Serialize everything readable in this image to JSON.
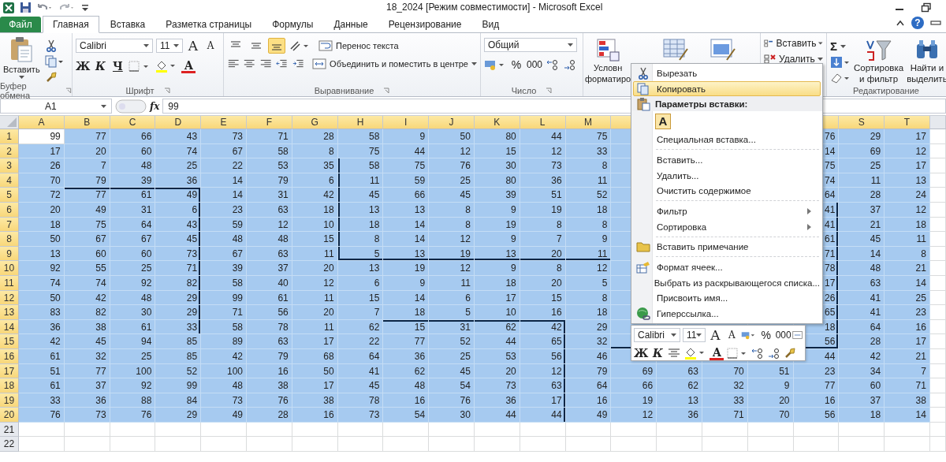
{
  "window": {
    "title": "18_2024  [Режим совместимости]  -  Microsoft Excel"
  },
  "tabs": [
    {
      "label": "Файл",
      "kind": "file",
      "selected": false
    },
    {
      "label": "Главная",
      "kind": "tab",
      "selected": true
    },
    {
      "label": "Вставка",
      "kind": "tab",
      "selected": false
    },
    {
      "label": "Разметка страницы",
      "kind": "tab",
      "selected": false
    },
    {
      "label": "Формулы",
      "kind": "tab",
      "selected": false
    },
    {
      "label": "Данные",
      "kind": "tab",
      "selected": false
    },
    {
      "label": "Рецензирование",
      "kind": "tab",
      "selected": false
    },
    {
      "label": "Вид",
      "kind": "tab",
      "selected": false
    }
  ],
  "help": {
    "label": "?"
  },
  "ribbon": {
    "clipboard": {
      "label": "Буфер обмена",
      "paste": "Вставить"
    },
    "font": {
      "label": "Шрифт",
      "name": "Calibri",
      "size": "11",
      "grow": "A",
      "shrink": "A",
      "bold": "Ж",
      "italic": "К",
      "underline": "Ч",
      "color_label": "A"
    },
    "alignment": {
      "label": "Выравнивание",
      "wrap": "Перенос текста",
      "merge": "Объединить и поместить в центре",
      "vertical": [
        {
          "kind": "top",
          "selected": false
        },
        {
          "kind": "middle",
          "selected": false
        },
        {
          "kind": "bottom",
          "selected": true
        }
      ]
    },
    "number": {
      "label": "Число",
      "format": "Общий",
      "percent": "%",
      "thousands": "000"
    },
    "styles": {
      "conditional": [
        "Условн",
        "форматиро"
      ]
    },
    "cells": {
      "insert": "Вставить",
      "delete": "Удалить"
    },
    "editing": {
      "label": "Редактирование",
      "sum": "Σ",
      "sort": [
        "Сортировка",
        "и фильтр"
      ],
      "find": [
        "Найти и",
        "выделить"
      ]
    }
  },
  "formula_bar": {
    "name_box": "A1",
    "function_label": "fx",
    "formula": "99"
  },
  "sheet": {
    "columns": [
      {
        "label": "A",
        "selected": true
      },
      {
        "label": "B",
        "selected": true
      },
      {
        "label": "C",
        "selected": true
      },
      {
        "label": "D",
        "selected": true
      },
      {
        "label": "E",
        "selected": true
      },
      {
        "label": "F",
        "selected": true
      },
      {
        "label": "G",
        "selected": true
      },
      {
        "label": "H",
        "selected": true
      },
      {
        "label": "I",
        "selected": true
      },
      {
        "label": "J",
        "selected": true
      },
      {
        "label": "K",
        "selected": true
      },
      {
        "label": "L",
        "selected": true
      },
      {
        "label": "M",
        "selected": true
      },
      null,
      null,
      null,
      null,
      {
        "selected": true
      },
      {
        "label": "S",
        "selected": true
      },
      {
        "label": "T",
        "selected": true
      }
    ],
    "rows": [
      {
        "num": "1",
        "selected": true,
        "cells": [
          {
            "text": "99",
            "active": true
          },
          "77",
          "66",
          "43",
          "73",
          "71",
          "28",
          "58",
          "9",
          "50",
          "80",
          "44",
          "75",
          null,
          null,
          null,
          null,
          "76",
          "29",
          "17"
        ]
      },
      {
        "num": "2",
        "selected": true,
        "cells": [
          "17",
          "20",
          "60",
          "74",
          "67",
          "58",
          "8",
          "75",
          "44",
          "12",
          "15",
          "12",
          "33",
          null,
          null,
          null,
          null,
          "14",
          "69",
          "12"
        ]
      },
      {
        "num": "3",
        "selected": true,
        "cells": [
          "26",
          "7",
          "48",
          "25",
          "22",
          "53",
          "35",
          "58",
          "75",
          "76",
          "30",
          "73",
          "8",
          null,
          null,
          null,
          null,
          "75",
          "25",
          "17"
        ]
      },
      {
        "num": "4",
        "selected": true,
        "cells": [
          "70",
          "79",
          "39",
          "36",
          "14",
          "79",
          "6",
          "11",
          "59",
          "25",
          "80",
          "36",
          "11",
          null,
          null,
          null,
          null,
          "74",
          "11",
          "13"
        ]
      },
      {
        "num": "5",
        "selected": true,
        "cells": [
          "72",
          "77",
          "61",
          "49",
          "14",
          "31",
          "42",
          "45",
          "66",
          "45",
          "39",
          "51",
          "52",
          null,
          null,
          null,
          null,
          "64",
          "28",
          "24"
        ]
      },
      {
        "num": "6",
        "selected": true,
        "cells": [
          "20",
          "49",
          "31",
          "6",
          "23",
          "63",
          "18",
          "13",
          "13",
          "8",
          "9",
          "19",
          "18",
          null,
          null,
          null,
          null,
          "41",
          "37",
          "12"
        ]
      },
      {
        "num": "7",
        "selected": true,
        "cells": [
          "18",
          "75",
          "64",
          "43",
          "59",
          "12",
          "10",
          "18",
          "14",
          "8",
          "19",
          "8",
          "8",
          null,
          null,
          null,
          null,
          "41",
          "21",
          "18"
        ]
      },
      {
        "num": "8",
        "selected": true,
        "cells": [
          "50",
          "67",
          "67",
          "45",
          "48",
          "48",
          "15",
          "8",
          "14",
          "12",
          "9",
          "7",
          "9",
          null,
          null,
          null,
          null,
          "61",
          "45",
          "11"
        ]
      },
      {
        "num": "9",
        "selected": true,
        "cells": [
          "13",
          "60",
          "60",
          "73",
          "67",
          "63",
          "11",
          "5",
          "13",
          "19",
          "13",
          "20",
          "11",
          null,
          null,
          null,
          null,
          "71",
          "14",
          "8"
        ]
      },
      {
        "num": "10",
        "selected": true,
        "cells": [
          "92",
          "55",
          "25",
          "71",
          "39",
          "37",
          "20",
          "13",
          "19",
          "12",
          "9",
          "8",
          "12",
          null,
          null,
          null,
          null,
          "78",
          "48",
          "21"
        ]
      },
      {
        "num": "11",
        "selected": true,
        "cells": [
          "74",
          "74",
          "92",
          "82",
          "58",
          "40",
          "12",
          "6",
          "9",
          "11",
          "18",
          "20",
          "5",
          null,
          null,
          null,
          null,
          "17",
          "63",
          "14"
        ]
      },
      {
        "num": "12",
        "selected": true,
        "cells": [
          "50",
          "42",
          "48",
          "29",
          "99",
          "61",
          "11",
          "15",
          "14",
          "6",
          "17",
          "15",
          "8",
          null,
          null,
          null,
          null,
          "26",
          "41",
          "25"
        ]
      },
      {
        "num": "13",
        "selected": true,
        "cells": [
          "83",
          "82",
          "30",
          "29",
          "71",
          "56",
          "20",
          "7",
          "18",
          "5",
          "10",
          "16",
          "18",
          null,
          null,
          null,
          null,
          "65",
          "41",
          "23"
        ]
      },
      {
        "num": "14",
        "selected": true,
        "cells": [
          "36",
          "38",
          "61",
          "33",
          "58",
          "78",
          "11",
          "62",
          "15",
          "31",
          "62",
          "42",
          "29",
          null,
          null,
          null,
          null,
          "18",
          "64",
          "16"
        ]
      },
      {
        "num": "15",
        "selected": true,
        "cells": [
          "42",
          "45",
          "94",
          "85",
          "89",
          "63",
          "17",
          "22",
          "77",
          "52",
          "44",
          "65",
          "32",
          null,
          null,
          null,
          null,
          "56",
          "28",
          "17"
        ]
      },
      {
        "num": "16",
        "selected": true,
        "cells": [
          "61",
          "32",
          "25",
          "85",
          "42",
          "79",
          "68",
          "64",
          "36",
          "25",
          "53",
          "56",
          "46",
          null,
          null,
          null,
          null,
          "44",
          "42",
          "21"
        ]
      },
      {
        "num": "17",
        "selected": true,
        "cells": [
          "51",
          "77",
          "100",
          "52",
          "100",
          "16",
          "50",
          "41",
          "62",
          "45",
          "20",
          "12",
          "79",
          "69",
          "63",
          "70",
          "51",
          "23",
          "34",
          "7"
        ]
      },
      {
        "num": "18",
        "selected": true,
        "cells": [
          "61",
          "37",
          "92",
          "99",
          "48",
          "38",
          "17",
          "45",
          "48",
          "54",
          "73",
          "63",
          "64",
          "66",
          "62",
          "32",
          "9",
          "77",
          "60",
          "71"
        ]
      },
      {
        "num": "19",
        "selected": true,
        "cells": [
          "33",
          "36",
          "88",
          "84",
          "73",
          "76",
          "38",
          "78",
          "16",
          "76",
          "36",
          "17",
          "16",
          "19",
          "13",
          "33",
          "20",
          "16",
          "37",
          "38"
        ]
      },
      {
        "num": "20",
        "selected": true,
        "cells": [
          "76",
          "73",
          "76",
          "29",
          "49",
          "28",
          "16",
          "73",
          "54",
          "30",
          "44",
          "44",
          "49",
          "12",
          "36",
          "71",
          "70",
          "56",
          "18",
          "14"
        ]
      },
      {
        "num": "21",
        "selected": false,
        "cells": [
          null,
          null,
          null,
          null,
          null,
          null,
          null,
          null,
          null,
          null,
          null,
          null,
          null,
          null,
          null,
          null,
          null,
          null,
          null,
          null
        ]
      },
      {
        "num": "22",
        "selected": false,
        "cells": [
          null,
          null,
          null,
          null,
          null,
          null,
          null,
          null,
          null,
          null,
          null,
          null,
          null,
          null,
          null,
          null,
          null,
          null,
          null,
          null
        ]
      }
    ]
  },
  "context_menu": {
    "items": [
      {
        "kind": "cut",
        "label": "Вырезать",
        "selected": false
      },
      {
        "kind": "copy",
        "label": "Копировать",
        "selected": true
      },
      {
        "kind": "paste_header",
        "label": "Параметры вставки:"
      },
      {
        "kind": "paste_option",
        "label": "A"
      },
      {
        "kind": "item",
        "label": "Специальная вставка...",
        "selected": false
      },
      {
        "kind": "separator"
      },
      {
        "kind": "item",
        "label": "Вставить...",
        "selected": false
      },
      {
        "kind": "item",
        "label": "Удалить...",
        "selected": false
      },
      {
        "kind": "item",
        "label": "Очистить содержимое",
        "selected": false
      },
      {
        "kind": "separator"
      },
      {
        "kind": "submenu",
        "label": "Фильтр",
        "selected": false
      },
      {
        "kind": "submenu",
        "label": "Сортировка",
        "selected": false
      },
      {
        "kind": "separator"
      },
      {
        "kind": "comment",
        "label": "Вставить примечание",
        "selected": false
      },
      {
        "kind": "separator"
      },
      {
        "kind": "format",
        "label": "Формат ячеек...",
        "selected": false
      },
      {
        "kind": "item",
        "label": "Выбрать из раскрывающегося списка...",
        "selected": false
      },
      {
        "kind": "item",
        "label": "Присвоить имя...",
        "selected": false
      },
      {
        "kind": "hyperlink",
        "label": "Гиперссылка...",
        "selected": false
      }
    ]
  },
  "mini_toolbar": {
    "font": "Calibri",
    "size": "11",
    "grow": "A",
    "shrink": "A",
    "percent": "%",
    "thousands": "000",
    "bold": "Ж",
    "italic": "К",
    "color_label": "A"
  }
}
